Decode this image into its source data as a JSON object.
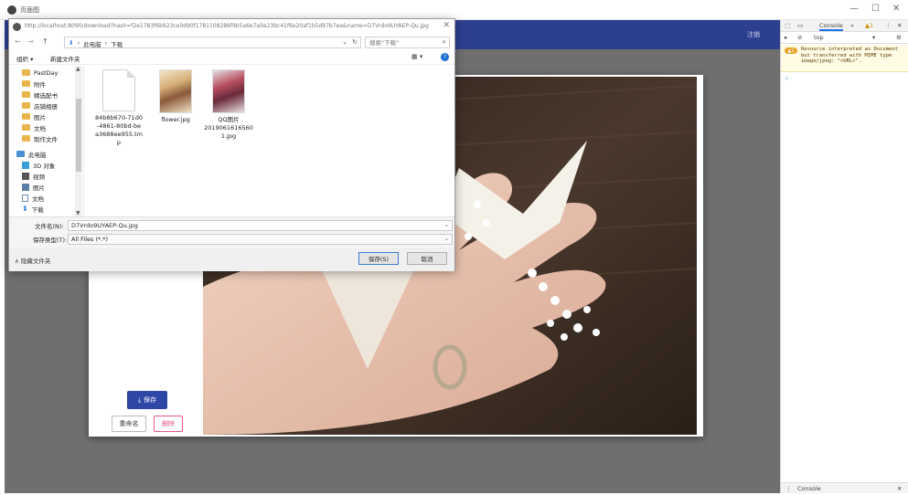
{
  "window": {
    "title": "页面图",
    "controls": {
      "minimize": "—",
      "maximize": "☐",
      "close": "✕"
    }
  },
  "app": {
    "header": {
      "logout_label": "注销"
    },
    "actions": {
      "save_label": "保存",
      "rename_label": "重命名",
      "delete_label": "删除"
    },
    "colors": {
      "header": "#2d3f8f",
      "primary": "#2e46a5",
      "danger": "#e5578c"
    }
  },
  "dialog": {
    "url": "http://localhost:8090/download?hash=f2e1783f6b923ce0d90f1781108286f9b5a6e7a0a23bc41f6e20af1b5d97b7ea&name=D7Vrdo9UYAEP-Qu.jpg",
    "close": "✕",
    "nav": {
      "back": "←",
      "forward": "→",
      "up": "↑"
    },
    "breadcrumb": [
      "此电脑",
      "下载"
    ],
    "search_placeholder": "搜索\"下载\"",
    "toolbar": {
      "organize": "组织 ▾",
      "new_folder": "新建文件夹",
      "view": "▦ ▾",
      "help": "?"
    },
    "nav_items": [
      {
        "label": "PastDay",
        "icon": "folder-icon"
      },
      {
        "label": "附件",
        "icon": "folder-icon"
      },
      {
        "label": "精选配书",
        "icon": "folder-icon"
      },
      {
        "label": "店铺相册",
        "icon": "folder-icon"
      },
      {
        "label": "图片",
        "icon": "folder-icon"
      },
      {
        "label": "文档",
        "icon": "folder-icon"
      },
      {
        "label": "制作文件",
        "icon": "folder-icon"
      },
      {
        "label": "此电脑",
        "icon": "pc-icon"
      },
      {
        "label": "3D 对象",
        "icon": "cube-icon"
      },
      {
        "label": "视频",
        "icon": "video-icon"
      },
      {
        "label": "图片",
        "icon": "picture-icon"
      },
      {
        "label": "文档",
        "icon": "document-icon"
      },
      {
        "label": "下载",
        "icon": "download-icon"
      }
    ],
    "files": [
      {
        "name": "84b8b670-71d0-4861-80bd-bea3688ee955.tmp",
        "lines": [
          "84b8b670-71d0",
          "-4861-80bd-be",
          "a3688ee955.tm",
          "p"
        ]
      },
      {
        "name": "flower.jpg",
        "lines": [
          "flower.jpg"
        ]
      },
      {
        "name": "QQ图片20190616165601.jpg",
        "lines": [
          "QQ图片",
          "2019061616560",
          "1.jpg"
        ]
      }
    ],
    "filename_label": "文件名(N):",
    "filename_value": "D7Vrdo9UYAEP-Qu.jpg",
    "filetype_label": "保存类型(T):",
    "filetype_value": "All Files (*.*)",
    "hide_folders_label": "∧ 隐藏文件夹",
    "save_label": "保存(S)",
    "cancel_label": "取消"
  },
  "devtools": {
    "tabs": {
      "console": "Console",
      "more": "»",
      "warn_count": "▲1",
      "menu": "⋮",
      "close": "✕"
    },
    "filter": {
      "context": "top",
      "dd": "▾"
    },
    "warning_badge": "▲1",
    "warning_text": "Resource interpreted as Document but transferred with MIME type image/jpeg: \"<URL>\".",
    "prompt": "›",
    "drawer_tab": "Console",
    "drawer_close": "✕"
  }
}
